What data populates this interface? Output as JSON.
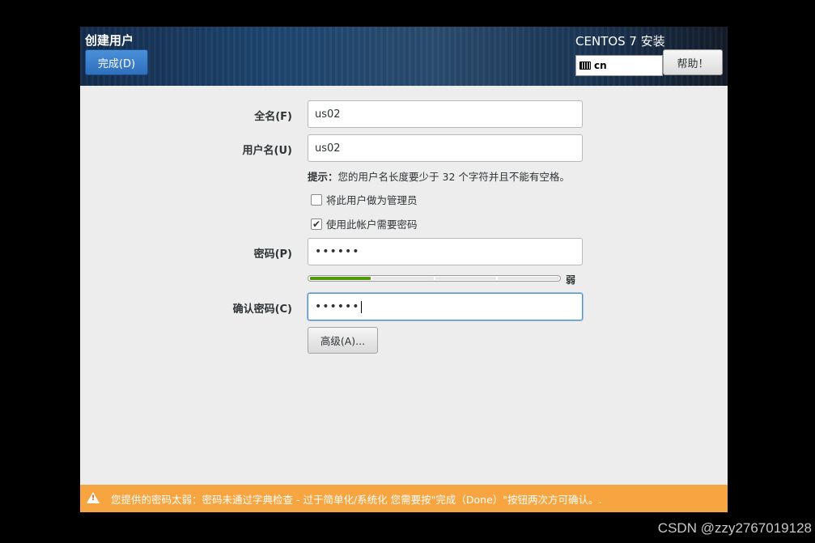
{
  "header": {
    "title": "创建用户",
    "done_label": "完成(D)",
    "product": "CENTOS 7 安装",
    "keyboard_layout": "cn",
    "help_label": "帮助！"
  },
  "form": {
    "fullname_label": "全名(F)",
    "fullname_value": "us02",
    "username_label": "用户名(U)",
    "username_value": "us02",
    "hint_bold": "提示：",
    "hint_text": "您的用户名长度要少于 32 个字符并且不能有空格。",
    "admin_label": "将此用户做为管理员",
    "admin_checked": false,
    "require_password_label": "使用此帐户需要密码",
    "require_password_checked": true,
    "password_label": "密码(P)",
    "password_value": "••••••",
    "strength_level": 1,
    "strength_segments": 4,
    "strength_color": "#4e9a06",
    "strength_text": "弱",
    "confirm_label": "确认密码(C)",
    "confirm_value": "••••••",
    "advanced_label": "高级(A)..."
  },
  "warning": {
    "text": "您提供的密码太弱：密码未通过字典检查 - 过于简单化/系统化 您需要按\"完成（Done）\"按钮两次方可确认。.",
    "color": "#f7a540"
  },
  "watermark": "CSDN @zzy2767019128"
}
